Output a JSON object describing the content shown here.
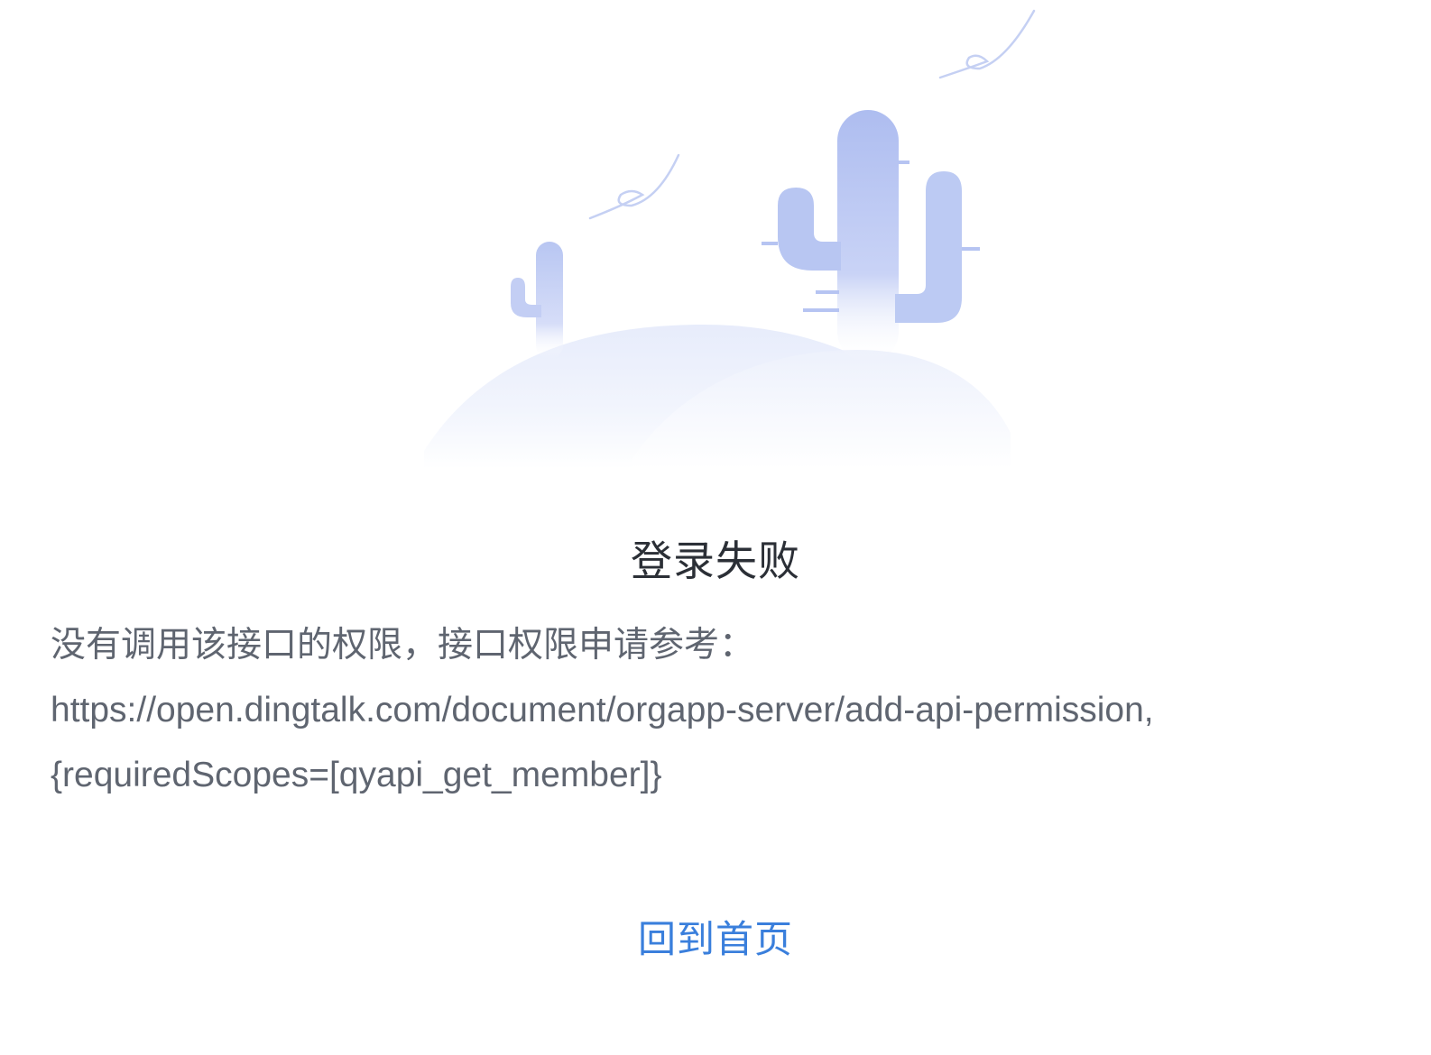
{
  "page": {
    "title": "登录失败",
    "message_lines": [
      "没有调用该接口的权限，接口权限申请参考：",
      "https://open.dingtalk.com/document/orgapp-server/add-api-permission,",
      "{requiredScopes=[qyapi_get_member]}"
    ],
    "home_link_label": "回到首页"
  },
  "illustration": {
    "icon": "cactus-desert-illustration"
  },
  "colors": {
    "title": "#2b2f36",
    "message": "#5f6570",
    "link": "#3a7fdc",
    "cactus": "#b6c4f2",
    "hill": "#eef1fb"
  }
}
